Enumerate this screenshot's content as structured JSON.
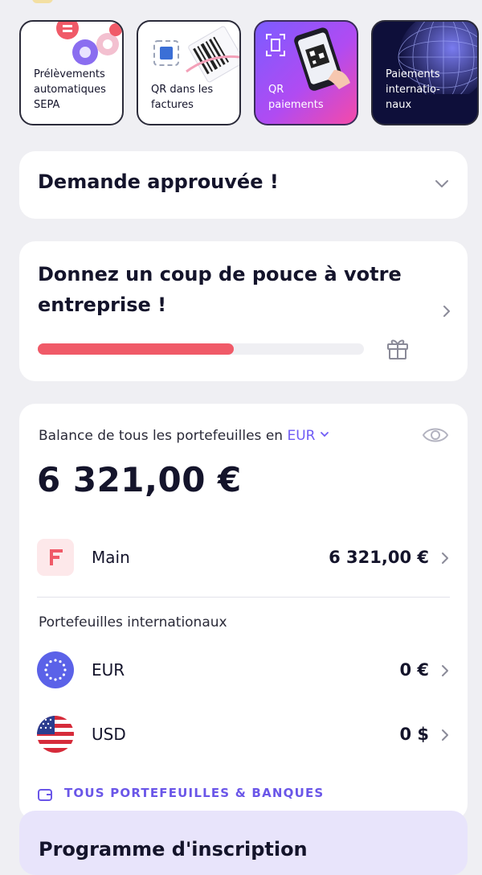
{
  "stories": [
    {
      "label_lines": [
        "Prélèvements",
        "automatiques",
        "SEPA"
      ]
    },
    {
      "label_lines": [
        "QR dans les",
        "factures"
      ]
    },
    {
      "label_lines": [
        "QR",
        "paiements"
      ]
    },
    {
      "label_lines": [
        "Paiements",
        "internatio-",
        "naux"
      ]
    }
  ],
  "approved": {
    "title": "Demande approuvée !"
  },
  "boost": {
    "title": "Donnez un coup de pouce à votre entreprise !",
    "progress_percent": 60
  },
  "balance": {
    "label": "Balance de tous les portefeuilles en ",
    "currency": "EUR",
    "amount": "6 321,00 €",
    "main": {
      "name": "Main",
      "value": "6 321,00 €"
    },
    "intl_label": "Portefeuilles internationaux",
    "eur": {
      "name": "EUR",
      "value": "0 €"
    },
    "usd": {
      "name": "USD",
      "value": "0 $"
    },
    "all_link": "TOUS PORTEFEUILLES & BANQUES"
  },
  "bottom": {
    "title": "Programme d'inscription"
  },
  "colors": {
    "accent": "#6f5bf5",
    "progress": "#f05a68",
    "brand_red": "#f05a68"
  },
  "icons": [
    "gift-icon",
    "eye-icon",
    "chevron-down-icon",
    "chevron-right-icon",
    "wallet-icon",
    "eu-flag-icon",
    "us-flag-icon",
    "brand-logo-icon"
  ]
}
